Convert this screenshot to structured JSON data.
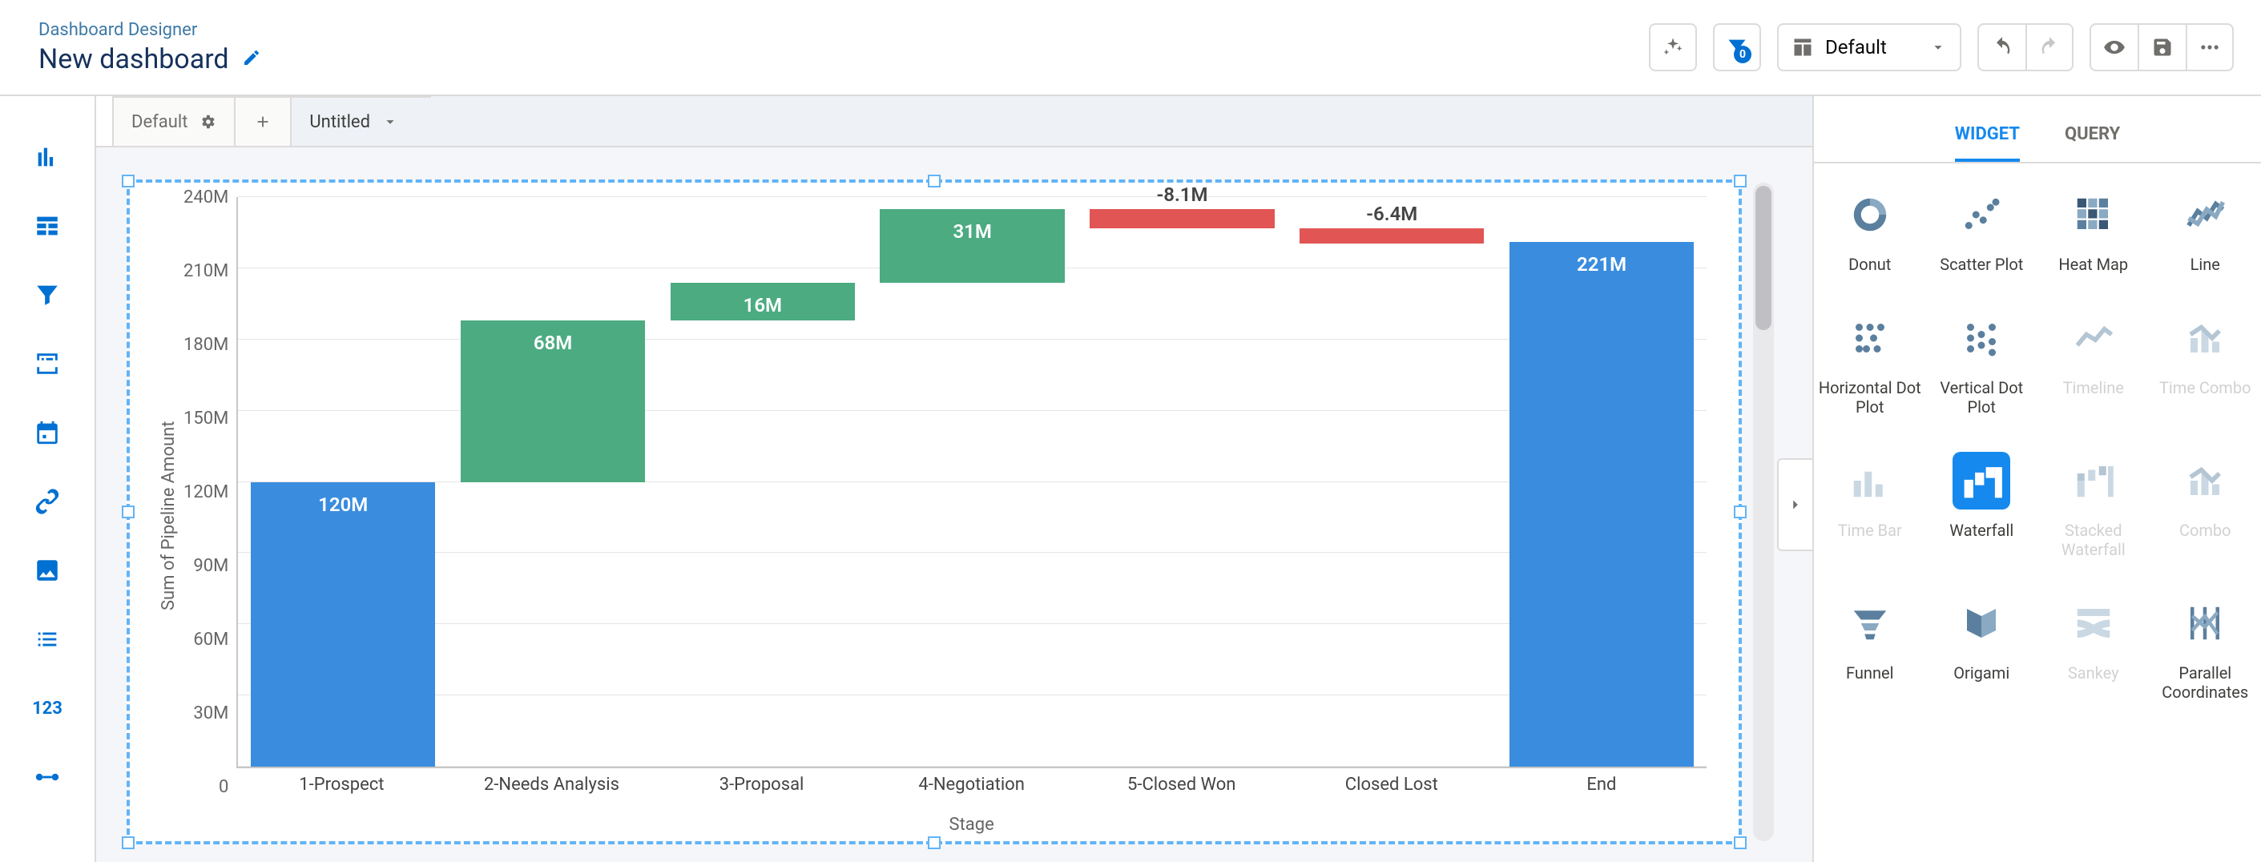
{
  "header": {
    "breadcrumb": "Dashboard Designer",
    "title": "New dashboard",
    "layout_label": "Default",
    "filter_count": "0"
  },
  "left_rail": {
    "number_widget": "123"
  },
  "page_tabs": {
    "default": "Default",
    "untitled": "Untitled"
  },
  "right_panel": {
    "tabs": {
      "widget": "WIDGET",
      "query": "QUERY"
    },
    "types": [
      {
        "id": "donut",
        "label": "Donut",
        "dim": false
      },
      {
        "id": "scatter",
        "label": "Scatter Plot",
        "dim": false
      },
      {
        "id": "heatmap",
        "label": "Heat Map",
        "dim": false
      },
      {
        "id": "line",
        "label": "Line",
        "dim": false
      },
      {
        "id": "hdot",
        "label": "Horizontal Dot Plot",
        "dim": false
      },
      {
        "id": "vdot",
        "label": "Vertical Dot Plot",
        "dim": false
      },
      {
        "id": "timeline",
        "label": "Timeline",
        "dim": true
      },
      {
        "id": "timecombo",
        "label": "Time Combo",
        "dim": true
      },
      {
        "id": "timebar",
        "label": "Time Bar",
        "dim": true
      },
      {
        "id": "waterfall",
        "label": "Waterfall",
        "dim": false,
        "selected": true
      },
      {
        "id": "stackedwf",
        "label": "Stacked Waterfall",
        "dim": true
      },
      {
        "id": "combo",
        "label": "Combo",
        "dim": true
      },
      {
        "id": "funnel",
        "label": "Funnel",
        "dim": false
      },
      {
        "id": "origami",
        "label": "Origami",
        "dim": false
      },
      {
        "id": "sankey",
        "label": "Sankey",
        "dim": true
      },
      {
        "id": "parcoord",
        "label": "Parallel Coordinates",
        "dim": false
      }
    ]
  },
  "chart_data": {
    "type": "bar",
    "subtype": "waterfall",
    "title": "",
    "xlabel": "Stage",
    "ylabel": "Sum of Pipeline Amount",
    "ylim": [
      0,
      240
    ],
    "yunit": "M",
    "yticks": [
      0,
      30,
      60,
      90,
      120,
      150,
      180,
      210,
      240
    ],
    "ytick_labels": [
      "0",
      "30M",
      "60M",
      "90M",
      "120M",
      "150M",
      "180M",
      "210M",
      "240M"
    ],
    "categories": [
      "1-Prospect",
      "2-Needs Analysis",
      "3-Proposal",
      "4-Negotiation",
      "5-Closed Won",
      "Closed Lost",
      "End"
    ],
    "values": [
      120,
      68,
      16,
      31,
      -8.1,
      -6.4,
      221
    ],
    "value_labels": [
      "120M",
      "68M",
      "16M",
      "31M",
      "-8.1M",
      "-6.4M",
      "221M"
    ],
    "roles": [
      "start",
      "inc",
      "inc",
      "inc",
      "dec",
      "dec",
      "end"
    ]
  }
}
